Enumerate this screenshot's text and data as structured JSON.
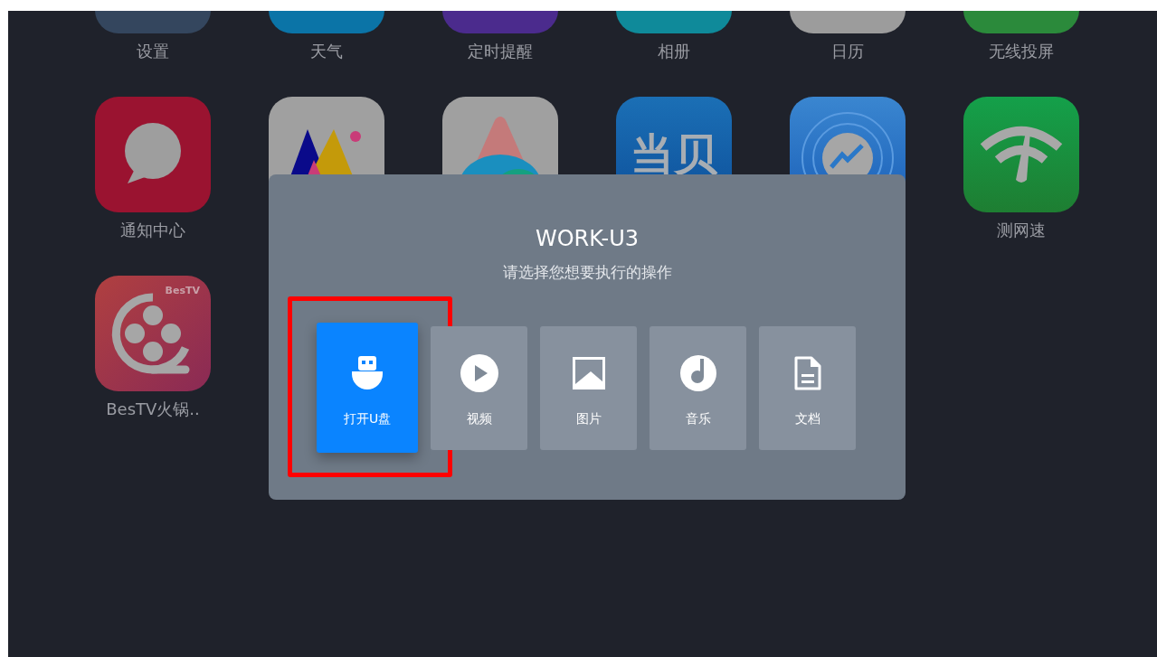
{
  "apps": [
    {
      "kind": "settings",
      "label": "设置"
    },
    {
      "kind": "weather",
      "label": "天气"
    },
    {
      "kind": "reminder",
      "label": "定时提醒"
    },
    {
      "kind": "album",
      "label": "相册"
    },
    {
      "kind": "calendar",
      "label": "日历"
    },
    {
      "kind": "cast",
      "label": "无线投屏"
    },
    {
      "kind": "message",
      "label": "通知中心"
    },
    {
      "kind": "painting"
    },
    {
      "kind": "rainbow"
    },
    {
      "kind": "logo",
      "logo_text": "当贝"
    },
    {
      "kind": "speed"
    },
    {
      "kind": "speedtest",
      "label": "测网速"
    },
    {
      "kind": "reel",
      "logo_text": "BesTV",
      "label": "BesTV火锅.."
    }
  ],
  "dialog": {
    "title": "WORK-U3",
    "subtitle": "请选择您想要执行的操作",
    "actions": [
      {
        "kind": "usb",
        "label": "打开U盘",
        "selected": true,
        "highlighted": true
      },
      {
        "kind": "video",
        "label": "视频",
        "selected": false,
        "highlighted": false
      },
      {
        "kind": "image",
        "label": "图片",
        "selected": false,
        "highlighted": false
      },
      {
        "kind": "music",
        "label": "音乐",
        "selected": false,
        "highlighted": false
      },
      {
        "kind": "document",
        "label": "文档",
        "selected": false,
        "highlighted": false
      }
    ]
  }
}
